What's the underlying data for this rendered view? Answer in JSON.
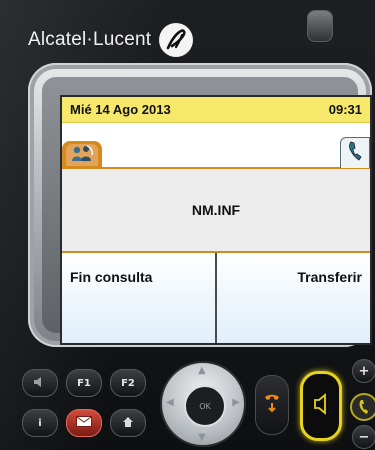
{
  "device": {
    "brand": "Alcatel·Lucent",
    "colors": {
      "accent_orange": "#d68a1c",
      "status_yellow": "#f6e86a",
      "speaker_ring": "#e7d21d"
    }
  },
  "screen": {
    "status": {
      "date": "Mié 14 Ago 2013",
      "time": "09:31"
    },
    "tabs": [
      {
        "icon": "call-on-hold-icon",
        "active": true
      },
      {
        "icon": "handset-icon",
        "active": false
      }
    ],
    "call": {
      "name": "NM.INF"
    },
    "softkeys": {
      "left": "Fin consulta",
      "right": "Transferir"
    }
  },
  "keypad": {
    "f1_label": "F1",
    "f2_label": "F2",
    "info_label": "i",
    "ok_label": "OK",
    "vol_up": "+",
    "vol_down": "−"
  }
}
